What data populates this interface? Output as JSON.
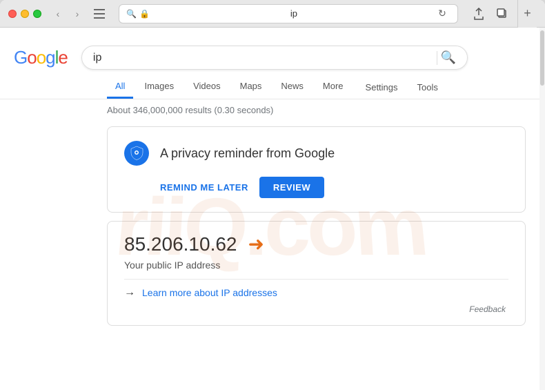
{
  "browser": {
    "address": "ip",
    "address_display": "🔍 🔒 ip",
    "back_label": "‹",
    "forward_label": "›"
  },
  "google": {
    "logo_letters": [
      {
        "char": "G",
        "color": "g-blue"
      },
      {
        "char": "o",
        "color": "g-red"
      },
      {
        "char": "o",
        "color": "g-yellow"
      },
      {
        "char": "g",
        "color": "g-blue"
      },
      {
        "char": "l",
        "color": "g-green"
      },
      {
        "char": "e",
        "color": "g-red"
      }
    ],
    "search_query": "ip"
  },
  "nav_tabs": {
    "tabs": [
      {
        "label": "All",
        "active": true
      },
      {
        "label": "Images",
        "active": false
      },
      {
        "label": "Videos",
        "active": false
      },
      {
        "label": "Maps",
        "active": false
      },
      {
        "label": "News",
        "active": false
      },
      {
        "label": "More",
        "active": false
      }
    ],
    "right_tabs": [
      {
        "label": "Settings"
      },
      {
        "label": "Tools"
      }
    ]
  },
  "results": {
    "count_text": "About 346,000,000 results (0.30 seconds)"
  },
  "privacy_card": {
    "title": "A privacy reminder from Google",
    "remind_label": "REMIND ME LATER",
    "review_label": "REVIEW"
  },
  "ip_card": {
    "ip_address": "85.206.10.62",
    "label": "Your public IP address",
    "learn_more": "Learn more about IP addresses"
  },
  "feedback": {
    "label": "Feedback"
  },
  "watermark": {
    "text": "riiQ.com"
  }
}
